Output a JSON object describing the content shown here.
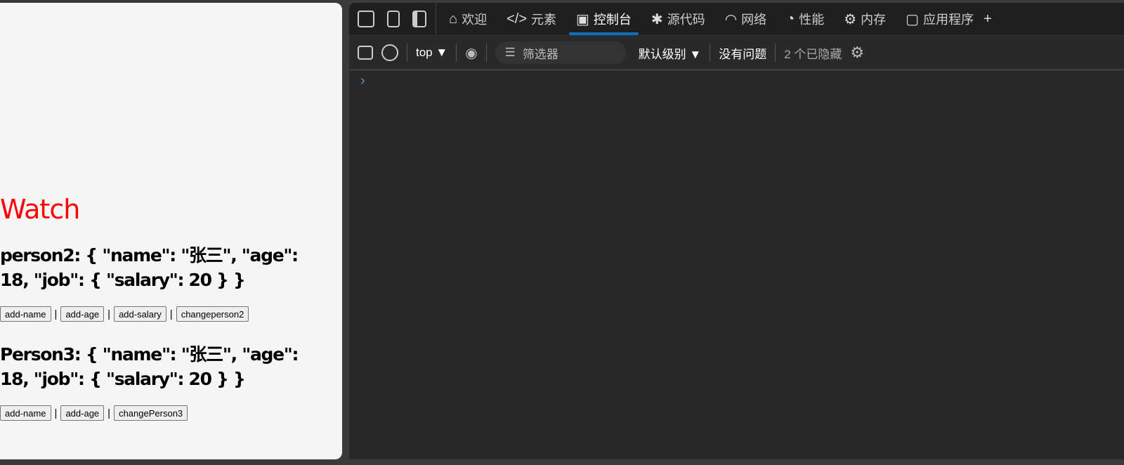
{
  "page": {
    "title": "Watch",
    "person2": {
      "text": "person2: { \"name\": \"张三\", \"age\": 18, \"job\": { \"salary\": 20 } }",
      "buttons": [
        "add-name",
        "add-age",
        "add-salary",
        "changeperson2"
      ]
    },
    "person3": {
      "text": "Person3: { \"name\": \"张三\", \"age\": 18, \"job\": { \"salary\": 20 } }",
      "buttons": [
        "add-name",
        "add-age",
        "changePerson3"
      ]
    },
    "separator": "|"
  },
  "devtools": {
    "tabs": [
      {
        "label": "欢迎",
        "icon": "home-icon"
      },
      {
        "label": "元素",
        "icon": "code-icon"
      },
      {
        "label": "控制台",
        "icon": "console-icon",
        "active": true
      },
      {
        "label": "源代码",
        "icon": "bug-icon"
      },
      {
        "label": "网络",
        "icon": "wifi-icon"
      },
      {
        "label": "性能",
        "icon": "gauge-icon"
      },
      {
        "label": "内存",
        "icon": "chip-icon"
      },
      {
        "label": "应用程序",
        "icon": "app-icon"
      }
    ],
    "more_tabs": "+",
    "toolbar": {
      "context": "top",
      "filter_placeholder": "筛选器",
      "level": "默认级别",
      "issues": "没有问题",
      "hidden": "2 个已隐藏"
    },
    "prompt": "›",
    "accent": "#0f6cbd"
  }
}
